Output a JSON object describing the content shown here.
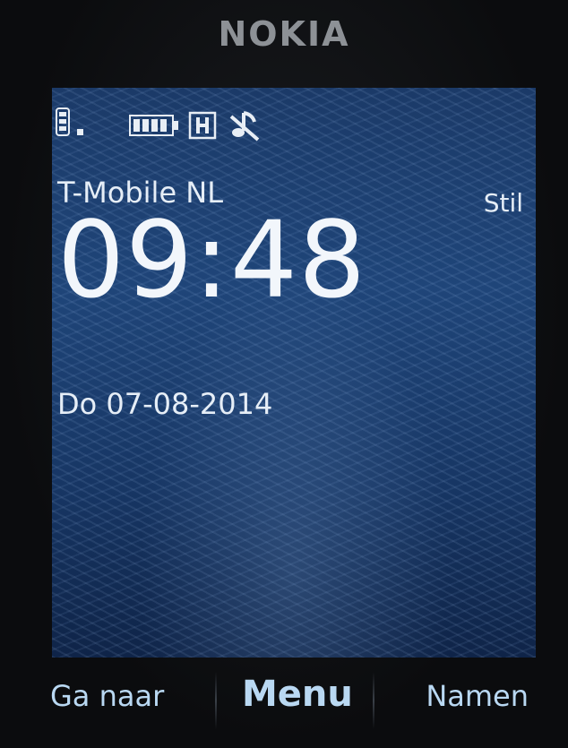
{
  "device": {
    "brand": "NOKIA"
  },
  "status_bar": {
    "network_type_icon": "gsm-icon",
    "signal_dot_icon": "signal-dot-icon",
    "battery_icon": "battery-icon",
    "data_icon": "hsdpa-h-icon",
    "profile_icon": "silent-profile-icon"
  },
  "home": {
    "operator": "T-Mobile  NL",
    "profile": "Stil",
    "time": "09:48",
    "date": "Do 07-08-2014"
  },
  "softkeys": {
    "left": "Ga naar",
    "middle": "Menu",
    "right": "Namen"
  },
  "colors": {
    "softkey_text": "#b9d8f2",
    "screen_text": "#e6eef7",
    "wallpaper": "#1f4579"
  }
}
